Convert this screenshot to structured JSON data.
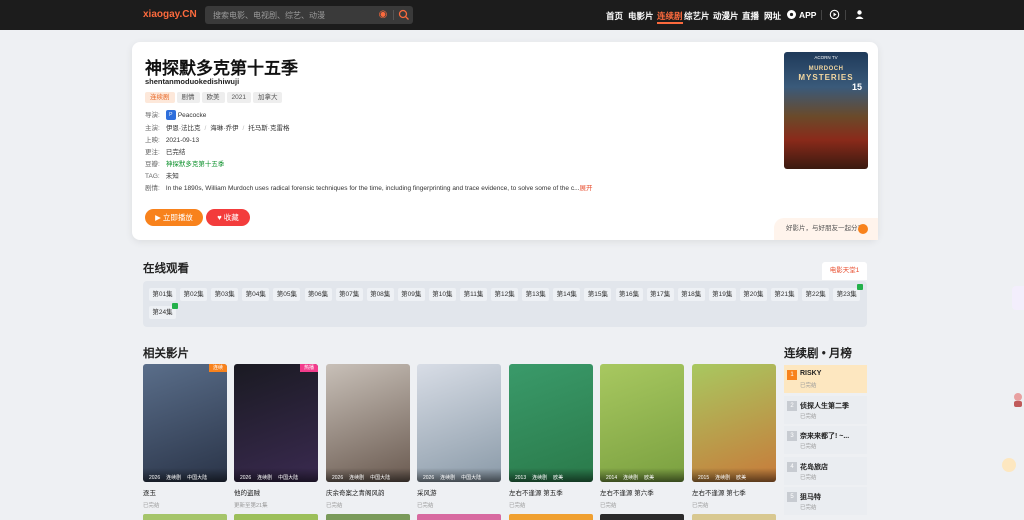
{
  "site": {
    "logo": "xiaogay.CN"
  },
  "search": {
    "placeholder": "搜索电影、电视剧、综艺、动漫"
  },
  "nav": [
    "首页",
    "电影片",
    "连续剧",
    "综艺片",
    "动漫片",
    "直播",
    "网址",
    "APP"
  ],
  "detail": {
    "title": "神探默多克第十五季",
    "pinyin": "shentanmoduokedishiwuji",
    "tags": [
      "连续剧",
      "剧情",
      "欧美",
      "2021",
      "加拿大"
    ],
    "platform_label": "导演:",
    "platform": "Peacocke",
    "cast_label": "主演:",
    "cast": [
      "伊恩·法比克",
      "海琳·乔伊",
      "托马斯·克雷格"
    ],
    "release_label": "上映:",
    "release": "2021-09-13",
    "update_label": "更注:",
    "update": "已完结",
    "alias_label": "豆瓣:",
    "alias": "神探默多克第十五季",
    "tag_label": "TAG:",
    "tag_value": "未知",
    "plot_label": "剧情:",
    "plot": "In the 1890s, William Murdoch uses radical forensic techniques for the time, including fingerprinting and trace evidence, to solve some of the c...",
    "plot_more": "展开",
    "play_btn": "立即播放",
    "fav_btn": "收藏",
    "share_text": "好影片，与好朋友一起分享",
    "poster": {
      "brand": "ACORN TV",
      "line1": "MURDOCH",
      "line2": "MYSTERIES",
      "season": "15"
    }
  },
  "online": {
    "title": "在线观看",
    "source": "电影天堂1",
    "episodes": [
      "第01集",
      "第02集",
      "第03集",
      "第04集",
      "第05集",
      "第06集",
      "第07集",
      "第08集",
      "第09集",
      "第10集",
      "第11集",
      "第12集",
      "第13集",
      "第14集",
      "第15集",
      "第16集",
      "第17集",
      "第18集",
      "第19集",
      "第20集",
      "第21集",
      "第22集",
      "第23集",
      "第24集"
    ]
  },
  "related": {
    "title": "相关影片",
    "items": [
      {
        "name": "逐玉",
        "sub": "已完结",
        "year": "2026",
        "type": "连续剧",
        "region": "中国大陆",
        "badge": "连续"
      },
      {
        "name": "他的盗贼",
        "sub": "更新至第21集",
        "year": "2026",
        "type": "连续剧",
        "region": "中国大陆",
        "badge": "热播"
      },
      {
        "name": "庆余奇案之青阁风韵",
        "sub": "已完结",
        "year": "2026",
        "type": "连续剧",
        "region": "中国大陆",
        "badge": ""
      },
      {
        "name": "采风游",
        "sub": "已完结",
        "year": "2026",
        "type": "连续剧",
        "region": "中国大陆",
        "badge": ""
      },
      {
        "name": "左右不逢源 第五季",
        "sub": "已完结",
        "year": "2013",
        "type": "连续剧",
        "region": "欧美",
        "badge": ""
      },
      {
        "name": "左右不逢源 第六季",
        "sub": "已完结",
        "year": "2014",
        "type": "连续剧",
        "region": "欧美",
        "badge": ""
      },
      {
        "name": "左右不逢源 第七季",
        "sub": "已完结",
        "year": "2015",
        "type": "连续剧",
        "region": "欧美",
        "badge": ""
      }
    ]
  },
  "ranking": {
    "title": "连续剧 • 月榜",
    "items": [
      {
        "rank": "1",
        "title": "RISKY",
        "sub": "已完结"
      },
      {
        "rank": "2",
        "title": "侦探人生第二季",
        "sub": "已完结"
      },
      {
        "rank": "3",
        "title": "奈来来都了! ~...",
        "sub": "已完结"
      },
      {
        "rank": "4",
        "title": "花岛旅店",
        "sub": "已完结"
      },
      {
        "rank": "5",
        "title": "狙马特",
        "sub": "已完结"
      }
    ]
  },
  "colors": {
    "accent": "#fc6a3d",
    "play": "#f8821c",
    "fav": "#f33c3c",
    "topbar": "#1c1c1c"
  }
}
